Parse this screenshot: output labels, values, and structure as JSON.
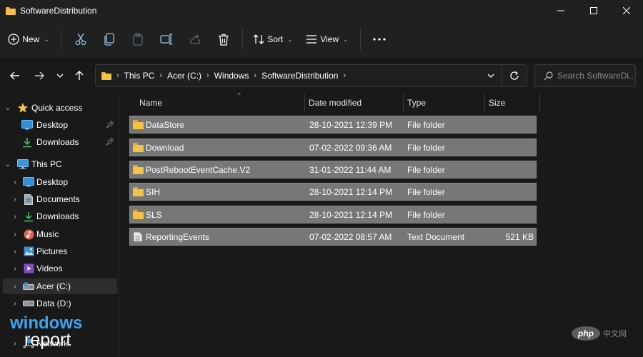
{
  "window": {
    "title": "SoftwareDistribution",
    "controls": [
      "minimize-icon",
      "maximize-icon",
      "close-icon"
    ]
  },
  "toolbar": {
    "new_label": "New",
    "sort_label": "Sort",
    "view_label": "View",
    "icons": [
      "plus-circle-icon",
      "cut-icon",
      "copy-icon",
      "paste-icon",
      "rename-icon",
      "share-icon",
      "delete-icon",
      "sort-icon",
      "view-icon",
      "more-icon"
    ]
  },
  "address": {
    "crumbs": [
      "This PC",
      "Acer (C:)",
      "Windows",
      "SoftwareDistribution"
    ],
    "search_placeholder": "Search SoftwareDi..."
  },
  "sidebar": {
    "items": [
      {
        "label": "Quick access",
        "icon": "star-icon"
      },
      {
        "label": "Desktop",
        "icon": "desktop-icon",
        "pinned": true
      },
      {
        "label": "Downloads",
        "icon": "download-icon",
        "pinned": true
      },
      {
        "label": "This PC",
        "icon": "monitor-icon"
      },
      {
        "label": "Desktop",
        "icon": "desktop-icon"
      },
      {
        "label": "Documents",
        "icon": "document-icon"
      },
      {
        "label": "Downloads",
        "icon": "download-icon"
      },
      {
        "label": "Music",
        "icon": "music-icon"
      },
      {
        "label": "Pictures",
        "icon": "picture-icon"
      },
      {
        "label": "Videos",
        "icon": "video-icon"
      },
      {
        "label": "Acer (C:)",
        "icon": "drive-icon",
        "selected": true
      },
      {
        "label": "Data (D:)",
        "icon": "drive-icon"
      },
      {
        "label": "Network",
        "icon": "network-icon"
      }
    ]
  },
  "table": {
    "columns": [
      "Name",
      "Date modified",
      "Type",
      "Size"
    ],
    "rows": [
      {
        "name": "DataStore",
        "date": "28-10-2021 12:39 PM",
        "type": "File folder",
        "size": "",
        "icon": "folder-icon"
      },
      {
        "name": "Download",
        "date": "07-02-2022 09:36 AM",
        "type": "File folder",
        "size": "",
        "icon": "folder-icon"
      },
      {
        "name": "PostRebootEventCache.V2",
        "date": "31-01-2022 11:44 AM",
        "type": "File folder",
        "size": "",
        "icon": "folder-icon"
      },
      {
        "name": "SIH",
        "date": "28-10-2021 12:14 PM",
        "type": "File folder",
        "size": "",
        "icon": "folder-icon"
      },
      {
        "name": "SLS",
        "date": "28-10-2021 12:14 PM",
        "type": "File folder",
        "size": "",
        "icon": "folder-icon"
      },
      {
        "name": "ReportingEvents",
        "date": "07-02-2022 08:57 AM",
        "type": "Text Document",
        "size": "521 KB",
        "icon": "text-file-icon"
      }
    ]
  },
  "watermarks": {
    "logo_top": "windows",
    "logo_bottom": "report",
    "php_text": "php",
    "php_suffix": "中文网"
  },
  "colors": {
    "background": "#191919",
    "chrome": "#202020",
    "selection": "#777777",
    "folder": "#f6c244",
    "accent_blue": "#3ba5f2"
  }
}
